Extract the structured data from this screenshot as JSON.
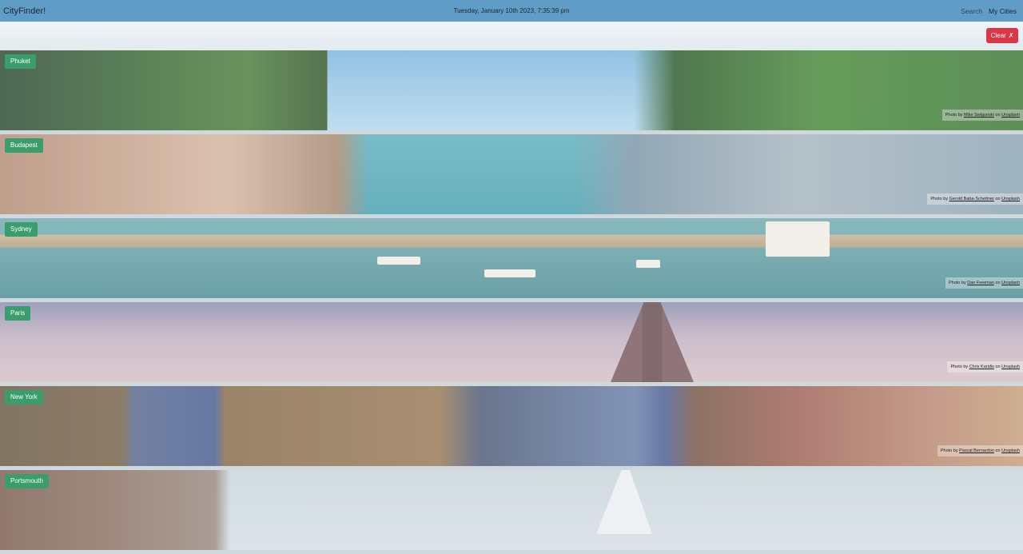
{
  "app": {
    "brand": "CityFinder!",
    "datetime": "Tuesday, January 10th 2023, 7:35:39 pm"
  },
  "nav": {
    "search": "Search",
    "my_cities": "My Cities"
  },
  "toolbar": {
    "clear_label": "Clear",
    "clear_icon": "✗"
  },
  "cities": [
    {
      "name": "Phuket",
      "credit_prefix": "Photo by",
      "photographer": "Mike Swigunski",
      "credit_on": "on",
      "source": "Unsplash"
    },
    {
      "name": "Budapest",
      "credit_prefix": "Photo by",
      "photographer": "Gerold Baba-Schettner",
      "credit_on": "on",
      "source": "Unsplash"
    },
    {
      "name": "Sydney",
      "credit_prefix": "Photo by",
      "photographer": "Dan Freeman",
      "credit_on": "on",
      "source": "Unsplash"
    },
    {
      "name": "Paris",
      "credit_prefix": "Photo by",
      "photographer": "Chris Karidis",
      "credit_on": "on",
      "source": "Unsplash"
    },
    {
      "name": "New York",
      "credit_prefix": "Photo by",
      "photographer": "Pascal Bernardon",
      "credit_on": "on",
      "source": "Unsplash"
    },
    {
      "name": "Portsmouth"
    }
  ],
  "colors": {
    "navbar": "#5f9cc6",
    "badge": "#3a9d6c",
    "clear_button": "#dc3545"
  }
}
